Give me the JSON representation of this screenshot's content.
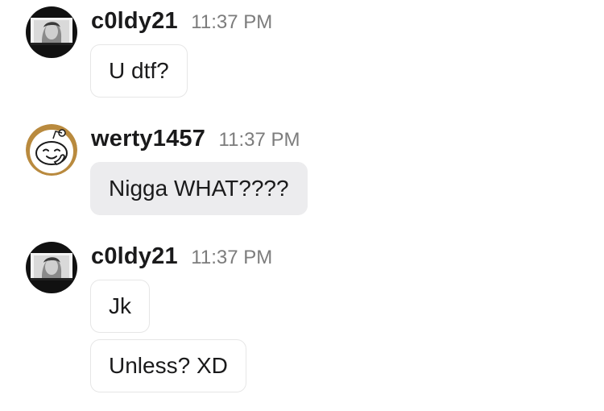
{
  "messages": [
    {
      "author": "c0ldy21",
      "avatar_icon": "user-photo-avatar-icon",
      "time": "11:37 PM",
      "bubbles": [
        "U dtf?"
      ]
    },
    {
      "author": "werty1457",
      "avatar_icon": "reddit-snoo-avatar-icon",
      "time": "11:37 PM",
      "bubbles": [
        "Nigga WHAT????"
      ]
    },
    {
      "author": "c0ldy21",
      "avatar_icon": "user-photo-avatar-icon",
      "time": "11:37 PM",
      "bubbles": [
        "Jk",
        "Unless? XD"
      ]
    }
  ],
  "colors": {
    "username": "#1a1a1b",
    "timestamp": "#7c7c7c",
    "own_bubble_border": "#e6e6e6",
    "other_bubble_fill": "#ececee",
    "snoo_ring": "#b98a3e"
  }
}
